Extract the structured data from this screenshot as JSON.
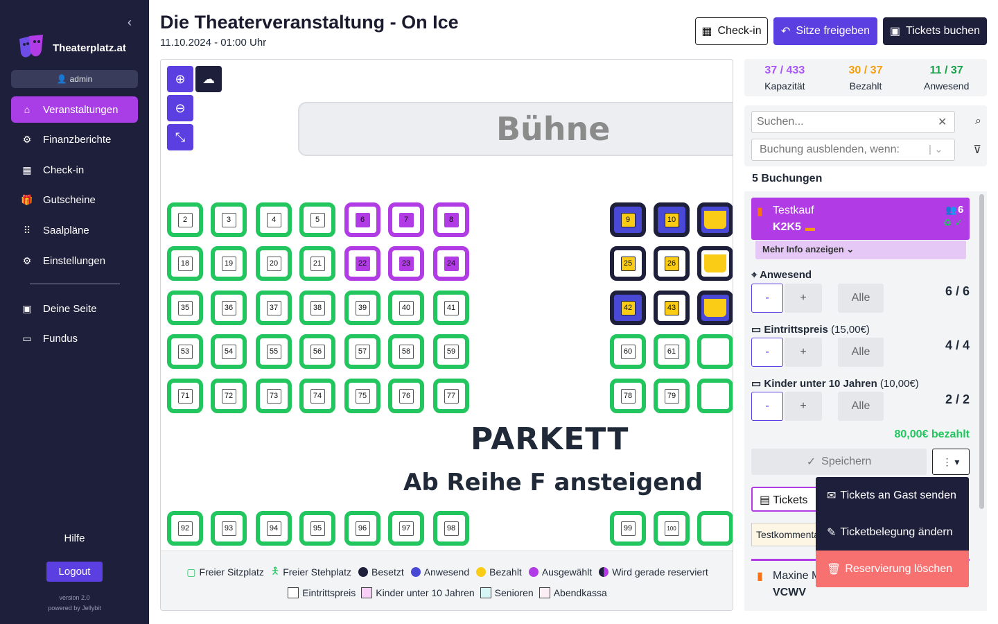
{
  "sidebar": {
    "brand": "Theaterplatz.at",
    "user": "admin",
    "items": [
      {
        "label": "Veranstaltungen",
        "icon": "home-icon",
        "glyph": "⌂"
      },
      {
        "label": "Finanzberichte",
        "icon": "finance-icon",
        "glyph": "⚙"
      },
      {
        "label": "Check-in",
        "icon": "qr-icon",
        "glyph": "▦"
      },
      {
        "label": "Gutscheine",
        "icon": "gift-icon",
        "glyph": "🎁"
      },
      {
        "label": "Saalpläne",
        "icon": "grid-icon",
        "glyph": "⠿"
      },
      {
        "label": "Einstellungen",
        "icon": "gear-icon",
        "glyph": "⚙"
      }
    ],
    "items2": [
      {
        "label": "Deine Seite",
        "icon": "book-icon",
        "glyph": "▣"
      },
      {
        "label": "Fundus",
        "icon": "box-icon",
        "glyph": "▭"
      }
    ],
    "help": "Hilfe",
    "logout": "Logout",
    "version": "version 2.0",
    "powered": "powered by Jellybit"
  },
  "header": {
    "title": "Die Theaterveranstaltung - On Ice",
    "date": "11.10.2024 - 01:00 Uhr",
    "checkin": "Check-in",
    "release": "Sitze freigeben",
    "book": "Tickets buchen"
  },
  "plan": {
    "stage": "Bühne",
    "parkett": "PARKETT",
    "ansteigend": "Ab Reihe F ansteigend",
    "rows": [
      [
        "2",
        "3",
        "4",
        "5",
        "6",
        "7",
        "8",
        "9",
        "10",
        ""
      ],
      [
        "18",
        "19",
        "20",
        "21",
        "22",
        "23",
        "24",
        "25",
        "26",
        ""
      ],
      [
        "35",
        "36",
        "37",
        "38",
        "39",
        "40",
        "41",
        "42",
        "43",
        ""
      ],
      [
        "53",
        "54",
        "55",
        "56",
        "57",
        "58",
        "59",
        "60",
        "61",
        ""
      ],
      [
        "71",
        "72",
        "73",
        "74",
        "75",
        "76",
        "77",
        "78",
        "79",
        ""
      ],
      [
        "92",
        "93",
        "94",
        "95",
        "96",
        "97",
        "98",
        "99",
        "100",
        ""
      ]
    ],
    "legend1": [
      "Freier Sitzplatz",
      "Freier Stehplatz",
      "Besetzt",
      "Anwesend",
      "Bezahlt",
      "Ausgewählt",
      "Wird gerade reserviert"
    ],
    "legend2": [
      "Eintrittspreis",
      "Kinder unter 10 Jahren",
      "Senioren",
      "Abendkassa"
    ]
  },
  "stats": [
    {
      "value": "37 / 433",
      "label": "Kapazität",
      "color": "#a855f7"
    },
    {
      "value": "30 / 37",
      "label": "Bezahlt",
      "color": "#f59e0b"
    },
    {
      "value": "11 / 37",
      "label": "Anwesend",
      "color": "#16a34a"
    }
  ],
  "filter": {
    "search_placeholder": "Suchen...",
    "hide_placeholder": "Buchung ausblenden, wenn:"
  },
  "bookings": {
    "count": "5 Buchungen",
    "card": {
      "name": "Testkauf",
      "code": "K2K5",
      "people": "6",
      "more": "Mehr Info anzeigen"
    },
    "cats": [
      {
        "name": "Anwesend",
        "price": "",
        "count": "6 / 6"
      },
      {
        "name": "Eintrittspreis",
        "price": "(15,00€)",
        "count": "4 / 4"
      },
      {
        "name": "Kinder unter 10 Jahren",
        "price": "(10,00€)",
        "count": "2 / 2"
      }
    ],
    "minus": "-",
    "plus": "+",
    "alle": "Alle",
    "paid": "80,00€ bezahlt",
    "save": "Speichern",
    "tickets": "Tickets",
    "comment": "Testkommentar",
    "next_name": "Maxine M",
    "next_code": "VCWV"
  },
  "menu": [
    "Tickets an Gast senden",
    "Ticketbelegung ändern",
    "Reservierung löschen"
  ]
}
